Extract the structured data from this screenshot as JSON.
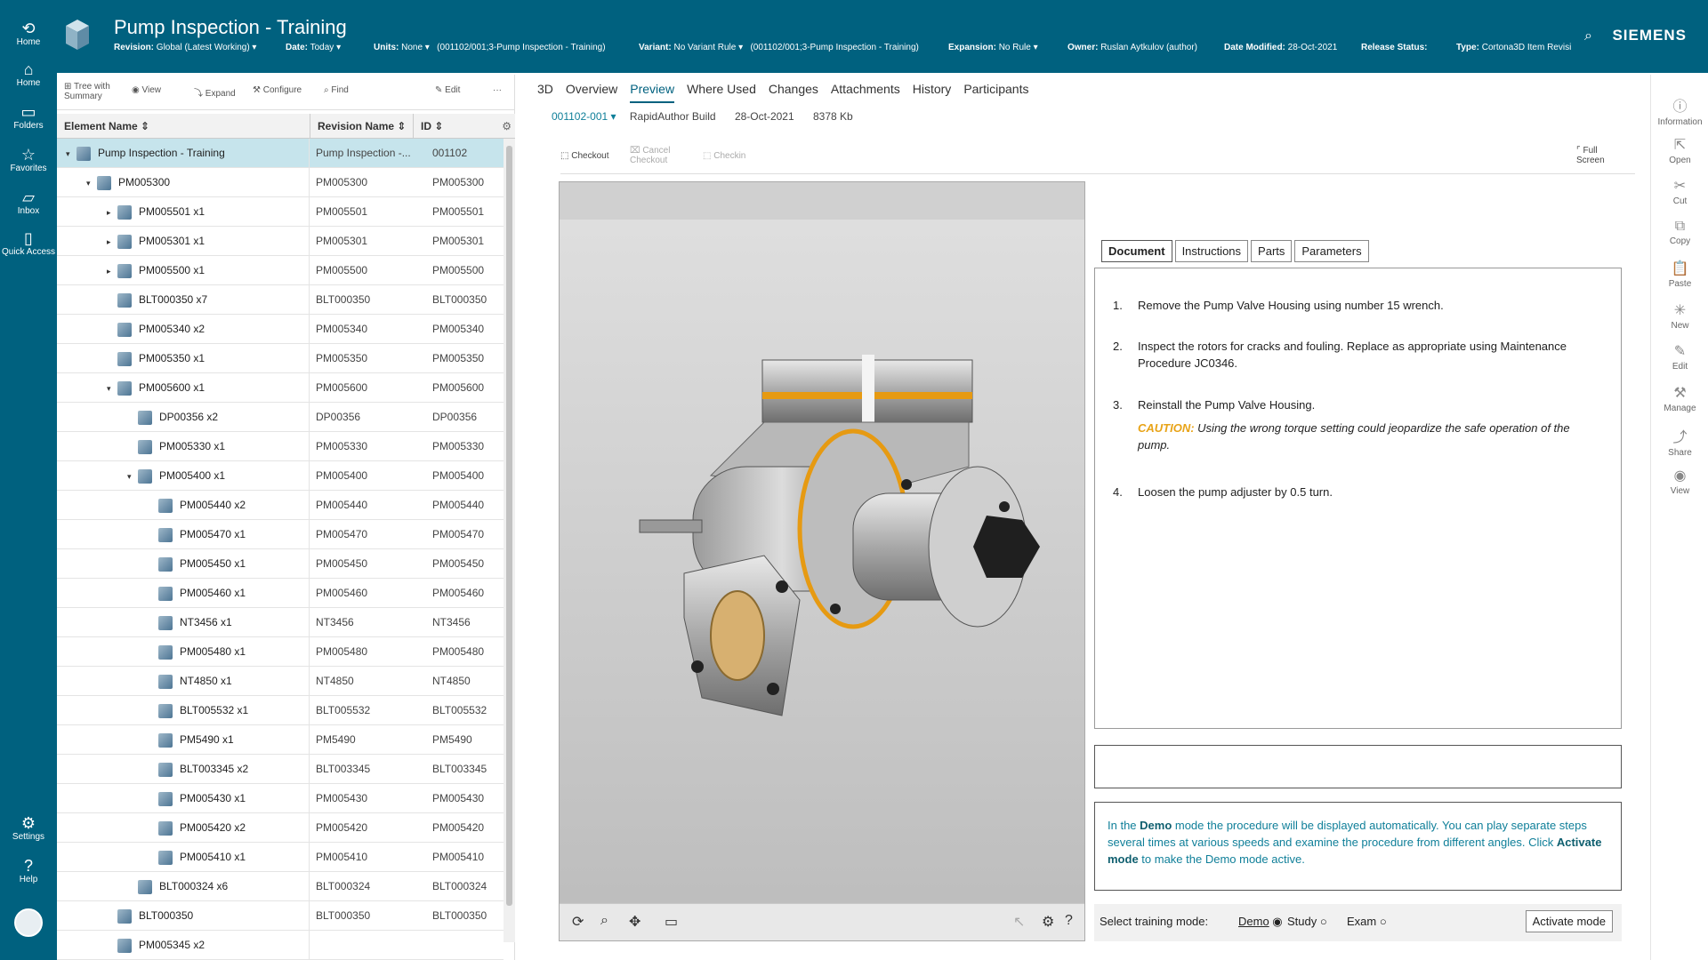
{
  "leftnav": {
    "items": [
      {
        "icon": "back-home-icon",
        "label": "Home"
      },
      {
        "icon": "home-icon",
        "label": "Home"
      },
      {
        "icon": "folder-icon",
        "label": "Folders"
      },
      {
        "icon": "star-icon",
        "label": "Favorites"
      },
      {
        "icon": "inbox-icon",
        "label": "Inbox"
      },
      {
        "icon": "quick-access-icon",
        "label": "Quick Access"
      }
    ],
    "settings": "Settings",
    "help": "Help"
  },
  "header": {
    "title": "Pump Inspection - Training",
    "brand": "SIEMENS",
    "revision_label": "Revision:",
    "revision_value": "Global (Latest Working)",
    "date_label": "Date:",
    "date_value": "Today",
    "units_label": "Units:",
    "units_value": "None",
    "units_item": "(001102/001;3-Pump Inspection - Training)",
    "variant_label": "Variant:",
    "variant_value": "No Variant Rule",
    "variant_item": "(001102/001;3-Pump Inspection - Training)",
    "expansion_label": "Expansion:",
    "expansion_value": "No Rule",
    "owner_label": "Owner:",
    "owner_value": "Ruslan Aytkulov (author)",
    "date_modified_label": "Date Modified:",
    "date_modified_value": "28-Oct-2021",
    "release_label": "Release Status:",
    "type_label": "Type:",
    "type_value": "Cortona3D Item Revisi"
  },
  "toolbar": {
    "tree_label": "Tree with Summary",
    "view_label": "View",
    "expand_label": "Expand",
    "configure_label": "Configure",
    "find_label": "Find",
    "edit_label": "Edit",
    "more_label": "···"
  },
  "table": {
    "columns": [
      "Element Name",
      "Revision Name",
      "ID"
    ],
    "rows": [
      {
        "name": "Pump Inspection - Training",
        "rev": "Pump Inspection -...",
        "id": "001102",
        "level": 0,
        "caret": "▾",
        "sel": true
      },
      {
        "name": "PM005300",
        "rev": "PM005300",
        "id": "PM005300",
        "level": 1,
        "caret": "▾"
      },
      {
        "name": "PM005501 x1",
        "rev": "PM005501",
        "id": "PM005501",
        "level": 2,
        "caret": "▸"
      },
      {
        "name": "PM005301 x1",
        "rev": "PM005301",
        "id": "PM005301",
        "level": 2,
        "caret": "▸"
      },
      {
        "name": "PM005500 x1",
        "rev": "PM005500",
        "id": "PM005500",
        "level": 2,
        "caret": "▸"
      },
      {
        "name": "BLT000350 x7",
        "rev": "BLT000350",
        "id": "BLT000350",
        "level": 2,
        "caret": ""
      },
      {
        "name": "PM005340 x2",
        "rev": "PM005340",
        "id": "PM005340",
        "level": 2,
        "caret": ""
      },
      {
        "name": "PM005350 x1",
        "rev": "PM005350",
        "id": "PM005350",
        "level": 2,
        "caret": ""
      },
      {
        "name": "PM005600 x1",
        "rev": "PM005600",
        "id": "PM005600",
        "level": 2,
        "caret": "▾"
      },
      {
        "name": "DP00356 x2",
        "rev": "DP00356",
        "id": "DP00356",
        "level": 3,
        "caret": ""
      },
      {
        "name": "PM005330 x1",
        "rev": "PM005330",
        "id": "PM005330",
        "level": 3,
        "caret": ""
      },
      {
        "name": "PM005400 x1",
        "rev": "PM005400",
        "id": "PM005400",
        "level": 3,
        "caret": "▾"
      },
      {
        "name": "PM005440 x2",
        "rev": "PM005440",
        "id": "PM005440",
        "level": 4,
        "caret": ""
      },
      {
        "name": "PM005470 x1",
        "rev": "PM005470",
        "id": "PM005470",
        "level": 4,
        "caret": ""
      },
      {
        "name": "PM005450 x1",
        "rev": "PM005450",
        "id": "PM005450",
        "level": 4,
        "caret": ""
      },
      {
        "name": "PM005460 x1",
        "rev": "PM005460",
        "id": "PM005460",
        "level": 4,
        "caret": ""
      },
      {
        "name": "NT3456 x1",
        "rev": "NT3456",
        "id": "NT3456",
        "level": 4,
        "caret": ""
      },
      {
        "name": "PM005480 x1",
        "rev": "PM005480",
        "id": "PM005480",
        "level": 4,
        "caret": ""
      },
      {
        "name": "NT4850 x1",
        "rev": "NT4850",
        "id": "NT4850",
        "level": 4,
        "caret": ""
      },
      {
        "name": "BLT005532 x1",
        "rev": "BLT005532",
        "id": "BLT005532",
        "level": 4,
        "caret": ""
      },
      {
        "name": "PM5490 x1",
        "rev": "PM5490",
        "id": "PM5490",
        "level": 4,
        "caret": ""
      },
      {
        "name": "BLT003345 x2",
        "rev": "BLT003345",
        "id": "BLT003345",
        "level": 4,
        "caret": ""
      },
      {
        "name": "PM005430 x1",
        "rev": "PM005430",
        "id": "PM005430",
        "level": 4,
        "caret": ""
      },
      {
        "name": "PM005420 x2",
        "rev": "PM005420",
        "id": "PM005420",
        "level": 4,
        "caret": ""
      },
      {
        "name": "PM005410 x1",
        "rev": "PM005410",
        "id": "PM005410",
        "level": 4,
        "caret": ""
      },
      {
        "name": "BLT000324 x6",
        "rev": "BLT000324",
        "id": "BLT000324",
        "level": 3,
        "caret": ""
      },
      {
        "name": "BLT000350",
        "rev": "BLT000350",
        "id": "BLT000350",
        "level": 2,
        "caret": ""
      },
      {
        "name": "PM005345 x2",
        "rev": "",
        "id": "",
        "level": 2,
        "caret": ""
      }
    ]
  },
  "main": {
    "tabs": [
      "3D",
      "Overview",
      "Preview",
      "Where Used",
      "Changes",
      "Attachments",
      "History",
      "Participants"
    ],
    "active_tab": "Preview",
    "version": "001102-001",
    "build": "RapidAuthor Build",
    "build_date": "28-Oct-2021",
    "size": "8378 Kb",
    "checkout": "Checkout",
    "cancel_checkout": "Cancel Checkout",
    "checkin": "Checkin",
    "fullscreen": "Full Screen"
  },
  "doc": {
    "tabs": [
      "Document",
      "Instructions",
      "Parts",
      "Parameters"
    ],
    "steps": [
      {
        "n": "1.",
        "text": "Remove the Pump Valve Housing using number 15 wrench."
      },
      {
        "n": "2.",
        "text": "Inspect the rotors for cracks and fouling. Replace as appropriate using Maintenance Procedure JC0346."
      },
      {
        "n": "3.",
        "text": "Reinstall the Pump Valve Housing."
      },
      {
        "n": "4.",
        "text": "Loosen the pump adjuster by 0.5 turn."
      }
    ],
    "caution_label": "CAUTION:",
    "caution_text": "Using the wrong torque setting could jeopardize the safe operation of the pump.",
    "info_1": "In the ",
    "info_demo": "Demo",
    "info_2": " mode the procedure will be displayed automatically. You can play separate steps several times at various speeds and examine the procedure from different angles. Click ",
    "info_activate": "Activate mode",
    "info_3": " to make the Demo mode active.",
    "mode_label": "Select training mode:",
    "mode_demo": "Demo",
    "mode_study": "Study",
    "mode_exam": "Exam",
    "activate_button": "Activate mode"
  },
  "rightrail": [
    "Information",
    "Open",
    "Cut",
    "Copy",
    "Paste",
    "New",
    "Edit",
    "Manage",
    "Share",
    "View"
  ],
  "colors": {
    "brand": "#00617f",
    "caution": "#e8a317",
    "accent_teal": "#0f7f99"
  }
}
